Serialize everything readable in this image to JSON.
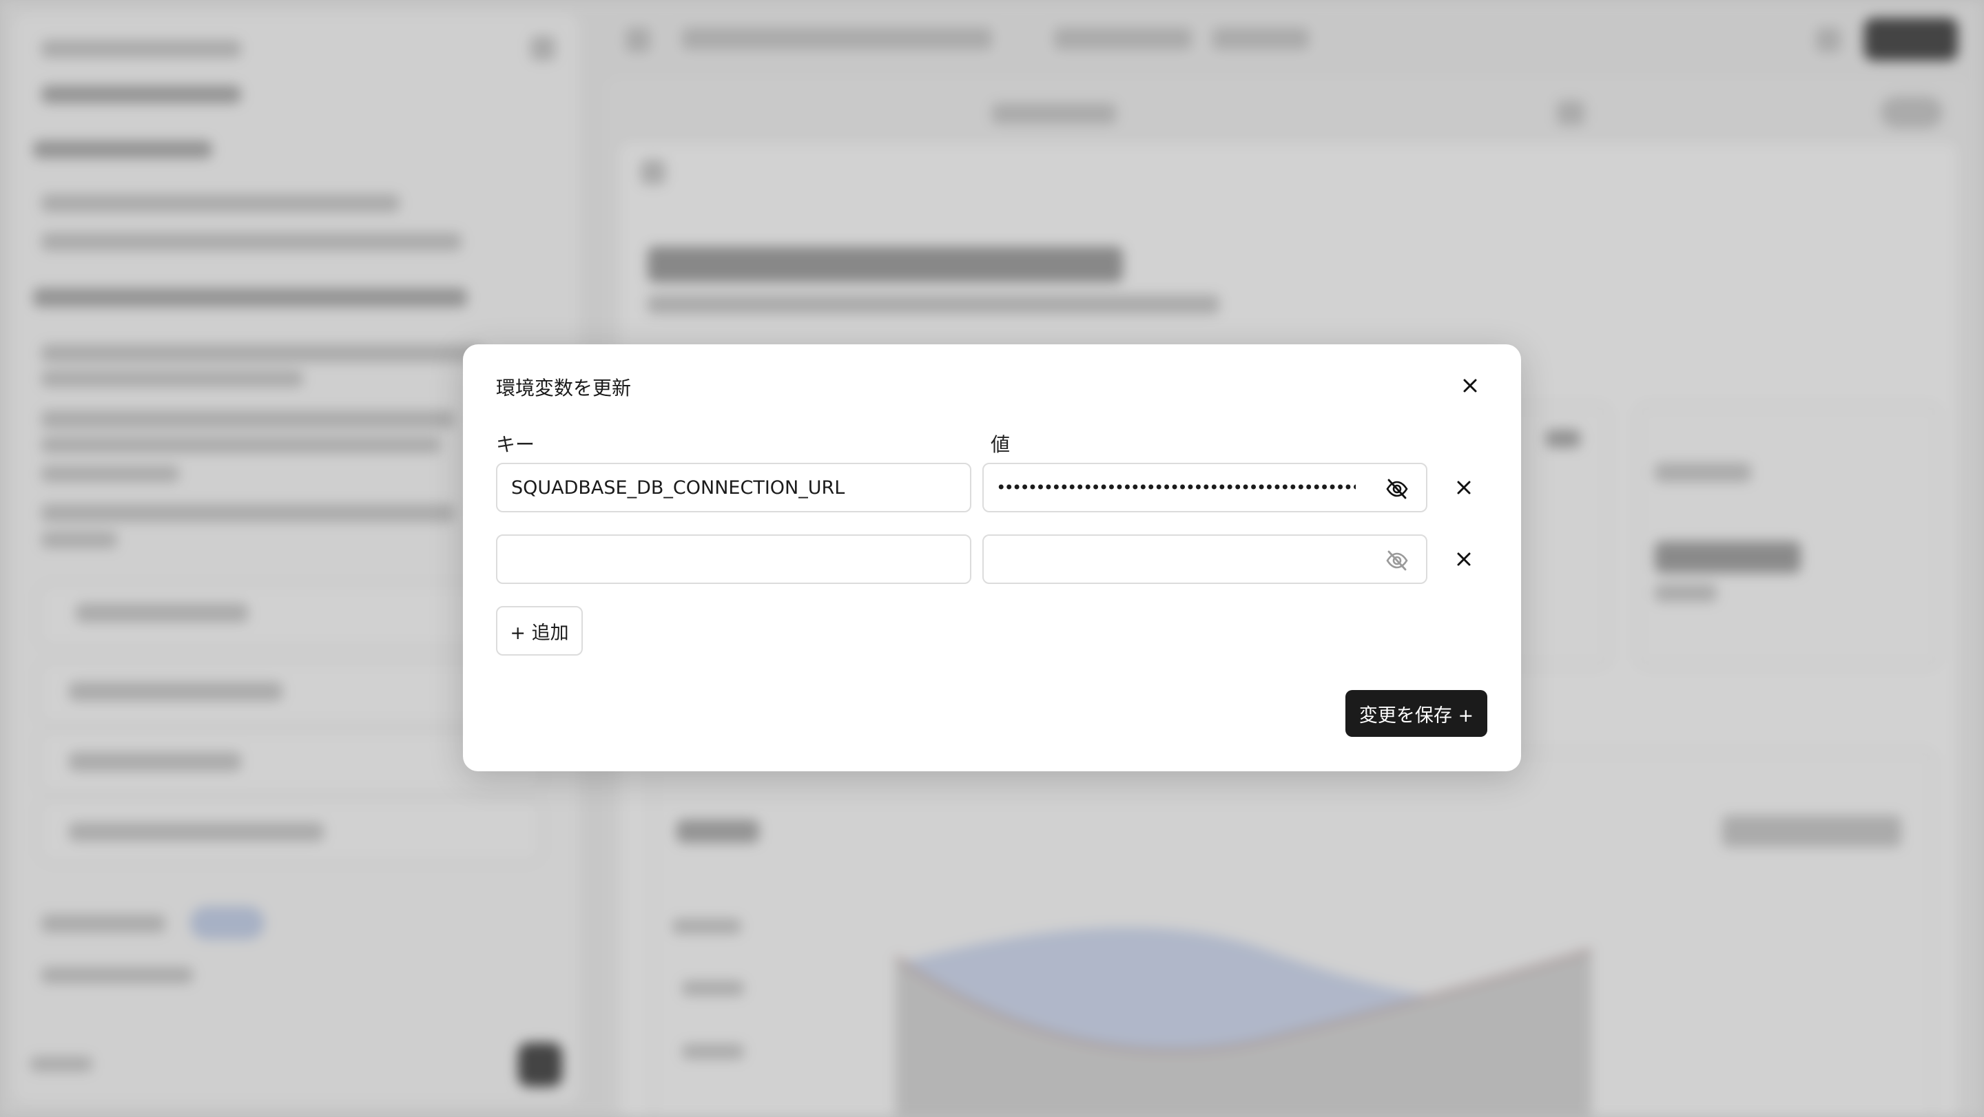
{
  "modal": {
    "title": "環境変数を更新",
    "key_label": "キー",
    "value_label": "値",
    "rows": [
      {
        "key": "SQUADBASE_DB_CONNECTION_URL",
        "value_masked": "••••••••••••••••••••••••••••••••••••••••••••••••"
      },
      {
        "key": "",
        "value_masked": ""
      }
    ],
    "add_label": "+ 追加",
    "save_label": "変更を保存 +"
  },
  "icons": {
    "close": "close-icon",
    "visibility": "eye-off-icon",
    "remove": "remove-row-icon"
  },
  "colors": {
    "primary_button": "#1b1b1b",
    "field_border": "#dcdcdc"
  }
}
